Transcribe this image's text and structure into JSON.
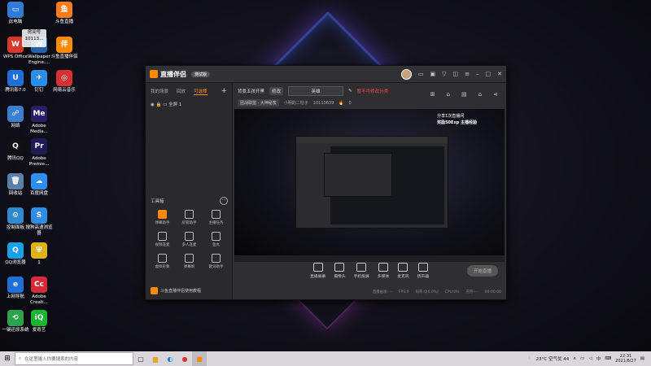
{
  "desktop": {
    "icons": [
      {
        "label": "此电脑",
        "glyph": "▭",
        "color": "#2f7bd6"
      },
      {
        "label": "斗鱼直播",
        "glyph": "鱼",
        "color": "#ff7a18"
      },
      {
        "label": "WPS Office",
        "glyph": "W",
        "color": "#d8372d"
      },
      {
        "label": "Wallpaper Engine:...",
        "glyph": "W",
        "color": "#2563a8"
      },
      {
        "label": "斗鱼直播伴侣",
        "glyph": "伴",
        "color": "#ff8a00"
      },
      {
        "label": "腾讯影7.0",
        "glyph": "U",
        "color": "#1e6fd8"
      },
      {
        "label": "钉钉",
        "glyph": "✈",
        "color": "#2b8de8"
      },
      {
        "label": "网易云音乐",
        "glyph": "◎",
        "color": "#d63030"
      },
      {
        "label": "网络",
        "glyph": "☍",
        "color": "#3b7fd1"
      },
      {
        "label": "Adobe Media...",
        "glyph": "Me",
        "color": "#2c1b66"
      },
      {
        "label": "腾讯QQ",
        "glyph": "Q",
        "color": "#111111"
      },
      {
        "label": "Adobe Premie...",
        "glyph": "Pr",
        "color": "#1f1b55"
      },
      {
        "label": "回收站",
        "glyph": "🗑",
        "color": "#5a7fa8"
      },
      {
        "label": "百度网盘",
        "glyph": "☁",
        "color": "#2f8ef0"
      },
      {
        "label": "控制面板",
        "glyph": "⚙",
        "color": "#2e8bd1"
      },
      {
        "label": "搜狗高速浏览器",
        "glyph": "S",
        "color": "#2f8de6"
      },
      {
        "label": "QQ浏览器",
        "glyph": "Q",
        "color": "#1aa0e8"
      },
      {
        "label": "1",
        "glyph": "⛨",
        "color": "#e0b21a"
      },
      {
        "label": "上网导航",
        "glyph": "e",
        "color": "#1e6fd8"
      },
      {
        "label": "Adobe Creati...",
        "glyph": "Cc",
        "color": "#d42a3a"
      },
      {
        "label": "一键还原系统",
        "glyph": "⟲",
        "color": "#2aa34a"
      },
      {
        "label": "爱奇艺",
        "glyph": "iQ",
        "color": "#19b531"
      }
    ],
    "room_badge": {
      "title": "房间号",
      "number": "10113..."
    }
  },
  "app": {
    "name": "直播伴侣",
    "badge": "测试版",
    "titlebar_icons": [
      "avatar",
      "message-icon",
      "gift-icon",
      "shield-icon",
      "skin-icon",
      "menu-icon",
      "minimize-icon",
      "maximize-icon",
      "close-icon"
    ],
    "left_tabs": [
      "我的场景",
      "回放",
      "可选择"
    ],
    "scene_label": "全屏 1",
    "tools_title": "工具箱",
    "tools": [
      {
        "label": "弹幕助手",
        "highlight": true
      },
      {
        "label": "房管助手",
        "highlight": false
      },
      {
        "label": "主播任务",
        "highlight": false
      },
      {
        "label": "视频连麦",
        "highlight": false
      },
      {
        "label": "多人连麦",
        "highlight": false
      },
      {
        "label": "鱼丸",
        "highlight": false
      },
      {
        "label": "虚拟形象",
        "highlight": false
      },
      {
        "label": "弹幕姬",
        "highlight": false
      },
      {
        "label": "歌词助手",
        "highlight": false
      }
    ],
    "promo": "斗鱼直播伴侣使用教程",
    "room": {
      "title": "背景五孩开黑",
      "edit": "修改",
      "category": "英雄",
      "warning": "暂不可修改分类",
      "tag": "团战联盟 · 大神秘笈",
      "anchor": "小明的二柱子",
      "room_id": "10113639",
      "fire": "0"
    },
    "right_icons": [
      "share-icon",
      "lock-icon",
      "gift-icon",
      "notice-icon",
      "link-icon"
    ],
    "overlay": {
      "line1": "分享1次直播间",
      "line2": "奖励50Exp 主播经验"
    },
    "bottom_buttons": [
      "直播屏幕",
      "摄像头",
      "手机投屏",
      "多媒体",
      "麦克风",
      "扬声器"
    ],
    "start_button": "开始直播",
    "status": [
      "直播画质:- -",
      "FPS:0",
      "码率:0(0.0%)",
      "CPU:0%",
      "内存:- -",
      "00:00:00"
    ]
  },
  "taskbar": {
    "search_placeholder": "在这里输入你要搜索的内容",
    "weather": "23°C 空气优 44",
    "lang": "中",
    "time": "22:31",
    "date": "2021/6/27"
  }
}
